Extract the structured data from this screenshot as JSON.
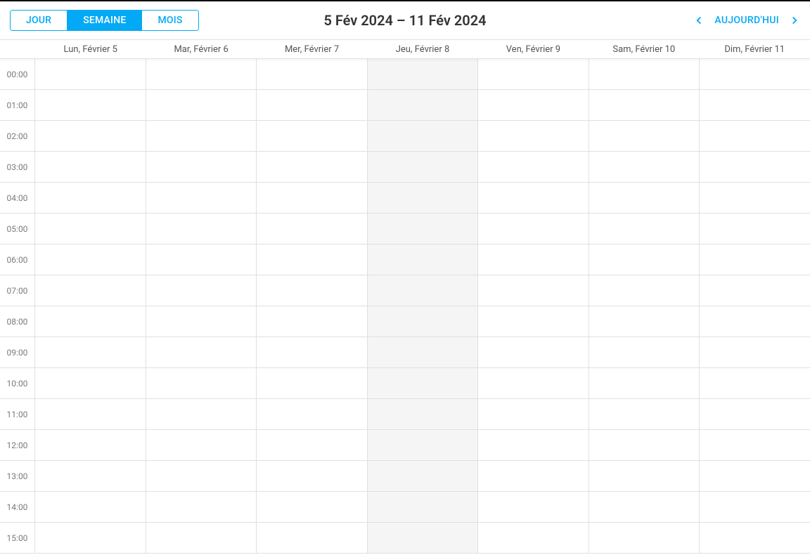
{
  "toolbar": {
    "views": {
      "day": "JOUR",
      "week": "SEMAINE",
      "month": "MOIS",
      "active": "week"
    },
    "title": "5 Fév 2024 – 11 Fév 2024",
    "today": "AUJOURD'HUI"
  },
  "days": [
    {
      "label": "Lun, Février 5",
      "highlight": false
    },
    {
      "label": "Mar, Février 6",
      "highlight": false
    },
    {
      "label": "Mer, Février 7",
      "highlight": false
    },
    {
      "label": "Jeu, Février 8",
      "highlight": true
    },
    {
      "label": "Ven, Février 9",
      "highlight": false
    },
    {
      "label": "Sam, Février 10",
      "highlight": false
    },
    {
      "label": "Dim, Février 11",
      "highlight": false
    }
  ],
  "hours": [
    "00:00",
    "01:00",
    "02:00",
    "03:00",
    "04:00",
    "05:00",
    "06:00",
    "07:00",
    "08:00",
    "09:00",
    "10:00",
    "11:00",
    "12:00",
    "13:00",
    "14:00",
    "15:00"
  ]
}
